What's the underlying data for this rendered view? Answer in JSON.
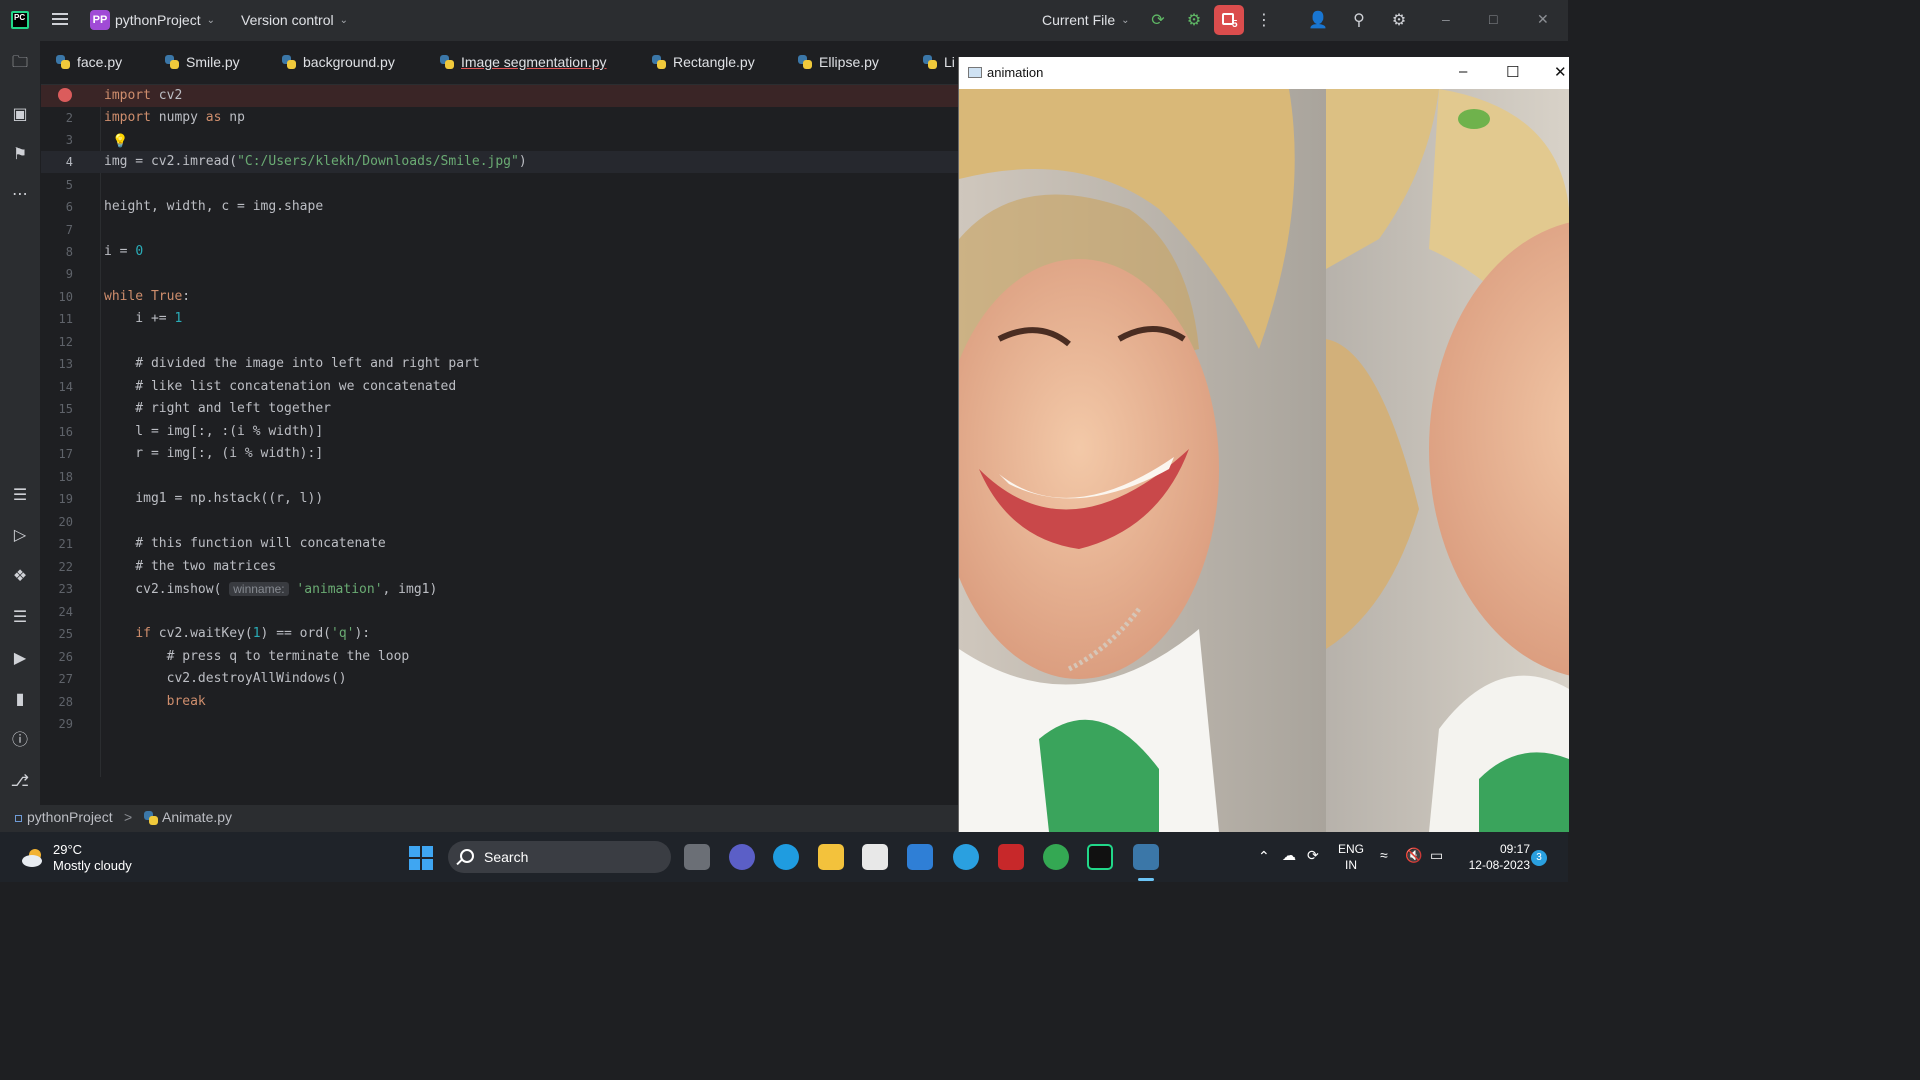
{
  "app": {
    "logo_text": "PC",
    "project_badge": "PP",
    "project_name": "pythonProject",
    "version_control": "Version control",
    "run_config": "Current File",
    "stop_count": "5"
  },
  "tabs": [
    {
      "label": "face.py"
    },
    {
      "label": "Smile.py"
    },
    {
      "label": "background.py"
    },
    {
      "label": "Image segmentation.py"
    },
    {
      "label": "Rectangle.py"
    },
    {
      "label": "Ellipse.py"
    },
    {
      "label": "Li"
    }
  ],
  "code_lines": [
    {
      "n": "1",
      "text": "import cv2"
    },
    {
      "n": "2",
      "text": "import numpy as np"
    },
    {
      "n": "3",
      "text": ""
    },
    {
      "n": "4",
      "text": "img = cv2.imread(\"C:/Users/klekh/Downloads/Smile.jpg\")"
    },
    {
      "n": "5",
      "text": ""
    },
    {
      "n": "6",
      "text": "height, width, c = img.shape"
    },
    {
      "n": "7",
      "text": ""
    },
    {
      "n": "8",
      "text": "i = 0"
    },
    {
      "n": "9",
      "text": ""
    },
    {
      "n": "10",
      "text": "while True:"
    },
    {
      "n": "11",
      "text": "    i += 1"
    },
    {
      "n": "12",
      "text": ""
    },
    {
      "n": "13",
      "text": "    # divided the image into left and right part"
    },
    {
      "n": "14",
      "text": "    # like list concatenation we concatenated"
    },
    {
      "n": "15",
      "text": "    # right and left together"
    },
    {
      "n": "16",
      "text": "    l = img[:, :(i % width)]"
    },
    {
      "n": "17",
      "text": "    r = img[:, (i % width):]"
    },
    {
      "n": "18",
      "text": ""
    },
    {
      "n": "19",
      "text": "    img1 = np.hstack((r, l))"
    },
    {
      "n": "20",
      "text": ""
    },
    {
      "n": "21",
      "text": "    # this function will concatenate"
    },
    {
      "n": "22",
      "text": "    # the two matrices"
    },
    {
      "n": "23",
      "text": "    cv2.imshow( winname: 'animation', img1)"
    },
    {
      "n": "24",
      "text": ""
    },
    {
      "n": "25",
      "text": "    if cv2.waitKey(1) == ord('q'):"
    },
    {
      "n": "26",
      "text": "        # press q to terminate the loop"
    },
    {
      "n": "27",
      "text": "        cv2.destroyAllWindows()"
    },
    {
      "n": "28",
      "text": "        break"
    },
    {
      "n": "29",
      "text": ""
    }
  ],
  "status_bar": {
    "project": "pythonProject",
    "separator": ">",
    "file": "Animate.py"
  },
  "animation_window": {
    "title": "animation",
    "minimize": "–",
    "maximize": "☐",
    "close": "✕"
  },
  "taskbar": {
    "temperature": "29°C",
    "weather": "Mostly cloudy",
    "search": "Search",
    "lang_top": "ENG",
    "lang_bottom": "IN",
    "time": "09:17",
    "date": "12-08-2023",
    "notification_count": "3"
  },
  "colors": {
    "ide_bg": "#1e1f22",
    "panel_bg": "#2b2d30",
    "keyword": "#cf8e6d",
    "string": "#6aab73",
    "number": "#2aacb8",
    "comment": "#7a7e85",
    "stop_button": "#db4d4d"
  }
}
